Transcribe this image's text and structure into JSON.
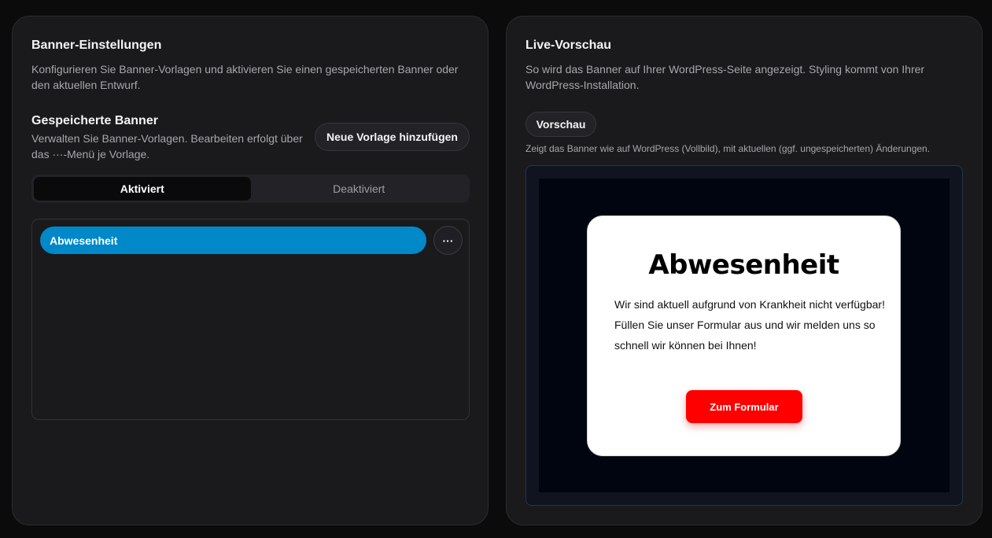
{
  "settings": {
    "title": "Banner-Einstellungen",
    "description": "Konfigurieren Sie Banner-Vorlagen und aktivieren Sie einen gespeicherten Banner oder den aktuellen Entwurf.",
    "saved": {
      "title": "Gespeicherte Banner",
      "description": "Verwalten Sie Banner-Vorlagen. Bearbeiten erfolgt über das ···-Menü je Vorlage.",
      "add_label": "Neue Vorlage hinzufügen"
    },
    "tabs": [
      {
        "label": "Aktiviert",
        "active": true
      },
      {
        "label": "Deaktiviert",
        "active": false
      }
    ],
    "templates": [
      {
        "label": "Abwesenheit",
        "menu_label": "···"
      }
    ]
  },
  "preview": {
    "title": "Live-Vorschau",
    "description": "So wird das Banner auf Ihrer WordPress-Seite angezeigt. Styling kommt von Ihrer WordPress-Installation.",
    "button_label": "Vorschau",
    "note": "Zeigt das Banner wie auf WordPress (Vollbild), mit aktuellen (ggf. ungespeicherten) Änderungen.",
    "banner": {
      "title": "Abwesenheit",
      "text_line1": "Wir sind aktuell aufgrund von Krankheit nicht verfügbar!",
      "text_line2": "Füllen Sie unser Formular aus und wir melden uns so schnell wir können bei Ihnen!",
      "cta_label": "Zum Formular"
    }
  },
  "colors": {
    "accent": "#0088c9",
    "cta": "#ff0000",
    "panel": "#1a1a1c",
    "background": "#0b0b0c"
  }
}
